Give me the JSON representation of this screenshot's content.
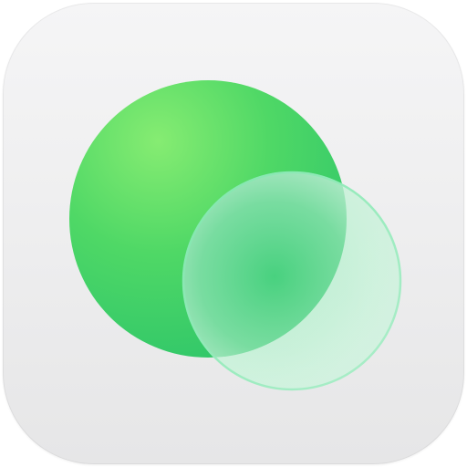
{
  "app_icon": {
    "icon_name": "overlapping-circles-icon",
    "colors": {
      "tile_light": "#f5f5f6",
      "tile_dark": "#e6e6e7",
      "large_circle_light": "#7ee870",
      "large_circle_mid": "#45d468",
      "large_circle_dark": "#2ec46a",
      "small_circle_tint": "#8ee6b4",
      "small_circle_rim": "#6fe0a4"
    }
  }
}
